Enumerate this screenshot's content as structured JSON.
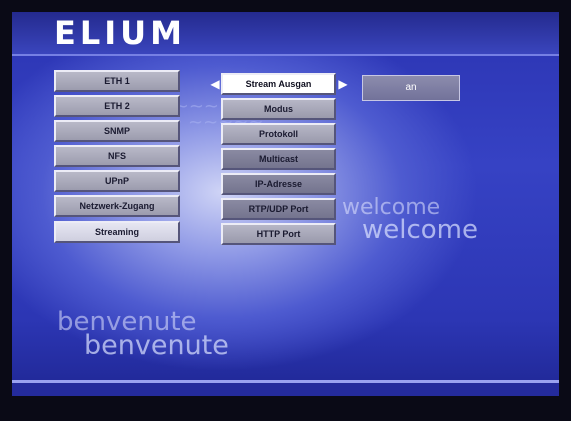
{
  "header": {
    "logo_text": "ELIUM"
  },
  "background_words": {
    "welcome_1": "welcome",
    "welcome_2": "welcome",
    "benvenute_1": "benvenute",
    "benvenute_2": "benvenute"
  },
  "main_menu": {
    "items": [
      {
        "label": "ETH 1"
      },
      {
        "label": "ETH 2"
      },
      {
        "label": "SNMP"
      },
      {
        "label": "NFS"
      },
      {
        "label": "UPnP"
      },
      {
        "label": "Netzwerk-Zugang"
      },
      {
        "label": "Streaming"
      }
    ],
    "selected": "Streaming"
  },
  "sub_menu": {
    "items": [
      {
        "label": "Stream Ausgan"
      },
      {
        "label": "Modus"
      },
      {
        "label": "Protokoll"
      },
      {
        "label": "Multicast"
      },
      {
        "label": "IP-Adresse"
      },
      {
        "label": "RTP/UDP Port"
      },
      {
        "label": "HTTP Port"
      }
    ],
    "focused": "Stream Ausgan"
  },
  "current_value": {
    "label": "an"
  },
  "icons": {
    "left": "arrow-left-icon",
    "right": "arrow-right-icon"
  },
  "colors": {
    "accent": "#2b34b2",
    "focus": "#ffffff",
    "value_box": "#7f7fa3"
  }
}
